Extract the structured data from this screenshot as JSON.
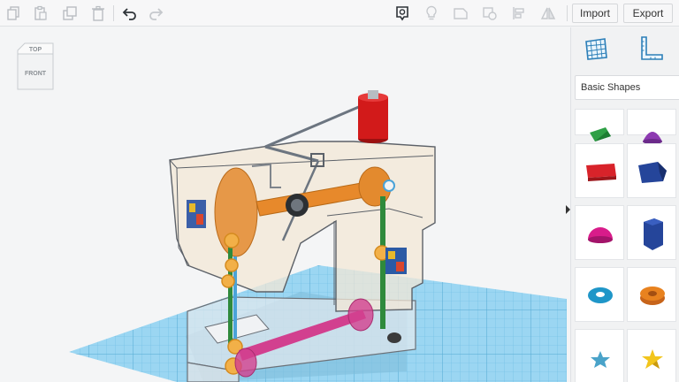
{
  "toolbar": {
    "import_label": "Import",
    "export_label": "Export",
    "icons": [
      "copy-icon",
      "paste-icon",
      "duplicate-icon",
      "delete-icon",
      "undo-icon",
      "redo-icon",
      "show-all-icon",
      "light-bulb-icon",
      "hole-icon",
      "group-icon",
      "align-icon",
      "mirror-icon"
    ]
  },
  "viewcube": {
    "top_label": "TOP",
    "front_label": "FRONT"
  },
  "panel": {
    "category": "Basic Shapes",
    "icons": [
      "workplane-icon",
      "ruler-icon"
    ],
    "shapes": [
      "pyramid",
      "paraboloid",
      "text",
      "polygon",
      "half-sphere",
      "hexagonal-prism",
      "torus",
      "tube",
      "star",
      "star"
    ]
  },
  "colors": {
    "accent": "#2c7fb8",
    "workplane": "#8fd1f0",
    "spool": "#d21a1a",
    "wheel": "#e38a2e",
    "rod": "#e7892b",
    "crank": "#d2408f"
  }
}
